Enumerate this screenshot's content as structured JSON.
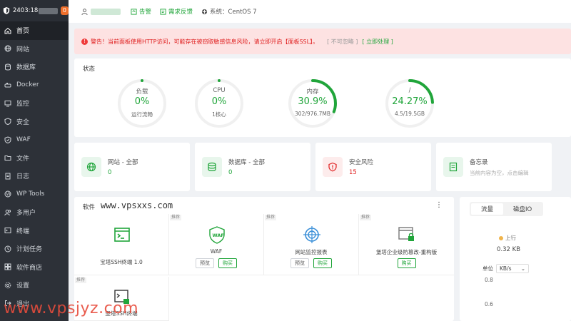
{
  "colors": {
    "accent": "#20a53a",
    "danger": "#e02020",
    "sidebar": "#2d3138",
    "warning": "#f0b44c"
  },
  "sidebar": {
    "ip": "2403:18",
    "badge": "0",
    "items": [
      {
        "label": "首页",
        "icon": "home-icon"
      },
      {
        "label": "网站",
        "icon": "globe-icon"
      },
      {
        "label": "数据库",
        "icon": "database-icon"
      },
      {
        "label": "Docker",
        "icon": "docker-icon"
      },
      {
        "label": "监控",
        "icon": "monitor-icon"
      },
      {
        "label": "安全",
        "icon": "shield-icon"
      },
      {
        "label": "WAF",
        "icon": "waf-icon"
      },
      {
        "label": "文件",
        "icon": "folder-icon"
      },
      {
        "label": "日志",
        "icon": "log-icon"
      },
      {
        "label": "WP Tools",
        "icon": "wordpress-icon"
      },
      {
        "label": "多用户",
        "icon": "users-icon"
      },
      {
        "label": "终端",
        "icon": "terminal-icon"
      },
      {
        "label": "计划任务",
        "icon": "clock-icon"
      },
      {
        "label": "软件商店",
        "icon": "store-icon"
      },
      {
        "label": "设置",
        "icon": "gear-icon"
      },
      {
        "label": "退出",
        "icon": "logout-icon"
      }
    ]
  },
  "topbar": {
    "alarm": "告警",
    "feedback": "需求反馈",
    "system": "系统：CentOS 7"
  },
  "alert": {
    "message": "警告！当前面板使用HTTP访问，可能存在被窃取敏感信息风险，请立即开启【面板SSL】。",
    "ignore": "[ 不可忽略 ]",
    "fix": "[ 立即处理 ]"
  },
  "status": {
    "title": "状态",
    "gauges": [
      {
        "label": "负载",
        "value": "0%",
        "sub": "运行流畅",
        "percent": 0
      },
      {
        "label": "CPU",
        "value": "0%",
        "sub": "1核心",
        "percent": 0
      },
      {
        "label": "内存",
        "value": "30.9%",
        "sub": "302/976.7MB",
        "percent": 30.9
      },
      {
        "label": "/",
        "value": "24.27%",
        "sub": "4.5/19.5GB",
        "percent": 24.27
      }
    ]
  },
  "overview": [
    {
      "label": "网站 - 全部",
      "value": "0",
      "icon": "globe-icon"
    },
    {
      "label": "数据库 - 全部",
      "value": "0",
      "icon": "database-icon"
    },
    {
      "label": "安全风险",
      "value": "15",
      "icon": "shield-alert-icon"
    },
    {
      "label": "备忘录",
      "sub": "当前内容为空，点击编辑",
      "icon": "memo-icon"
    }
  ],
  "software": {
    "title": "软件",
    "watermark": "www.vpsxxs.com",
    "items": [
      {
        "tag": "",
        "name": "宝塔SSH终端 1.0"
      },
      {
        "tag": "推荐",
        "name": "WAF",
        "btn1": "预览",
        "btn2": "购买"
      },
      {
        "tag": "推荐",
        "name": "网站监控报表",
        "btn1": "预览",
        "btn2": "购买"
      },
      {
        "tag": "推荐",
        "name": "堡塔企业级防篡改-重构版",
        "btn2": "购买"
      },
      {
        "tag": "推荐",
        "name": "堡塔SSH终端"
      }
    ]
  },
  "traffic": {
    "tabs": [
      "流量",
      "磁盘IO"
    ],
    "legend": "上行",
    "up_value": "0.32 KB",
    "unit_label": "单位",
    "unit": "KB/s",
    "axis": [
      "0.8",
      "0.6"
    ]
  },
  "watermark_bottom": "www.vpsjyz.com"
}
